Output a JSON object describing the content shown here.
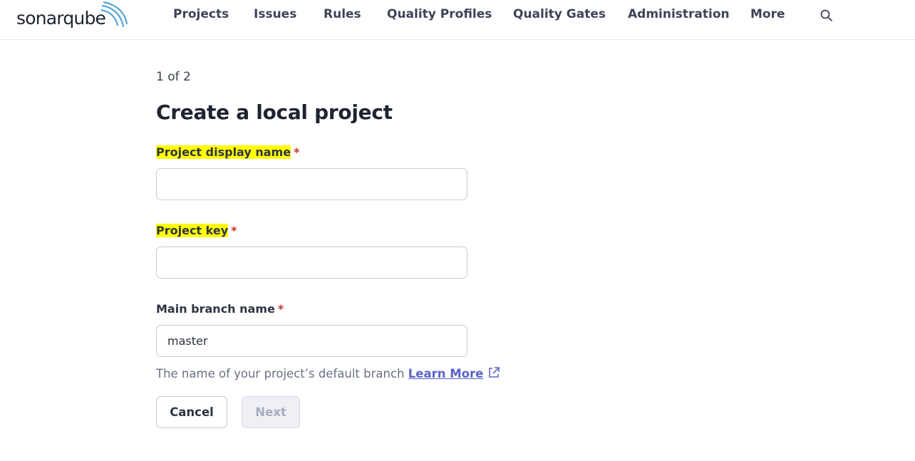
{
  "app": {
    "logo_regular": "sonar",
    "logo_bold": "qube"
  },
  "nav": {
    "items": [
      "Projects",
      "Issues",
      "Rules",
      "Quality Profiles",
      "Quality Gates",
      "Administration",
      "More"
    ],
    "search_icon": "search-icon"
  },
  "page": {
    "step": "1 of 2",
    "title": "Create a local project"
  },
  "form": {
    "display_name": {
      "label": "Project display name",
      "required_marker": "*",
      "value": ""
    },
    "project_key": {
      "label": "Project key",
      "required_marker": "*",
      "value": ""
    },
    "main_branch": {
      "label": "Main branch name",
      "required_marker": "*",
      "value": "master",
      "help": "The name of your project’s default branch",
      "learn_more": "Learn More"
    }
  },
  "buttons": {
    "cancel": "Cancel",
    "next": "Next"
  },
  "colors": {
    "highlight": "#ffff00",
    "link": "#5a63c9",
    "required": "#c0392b",
    "logo_arcs": "#4a9fd6"
  }
}
